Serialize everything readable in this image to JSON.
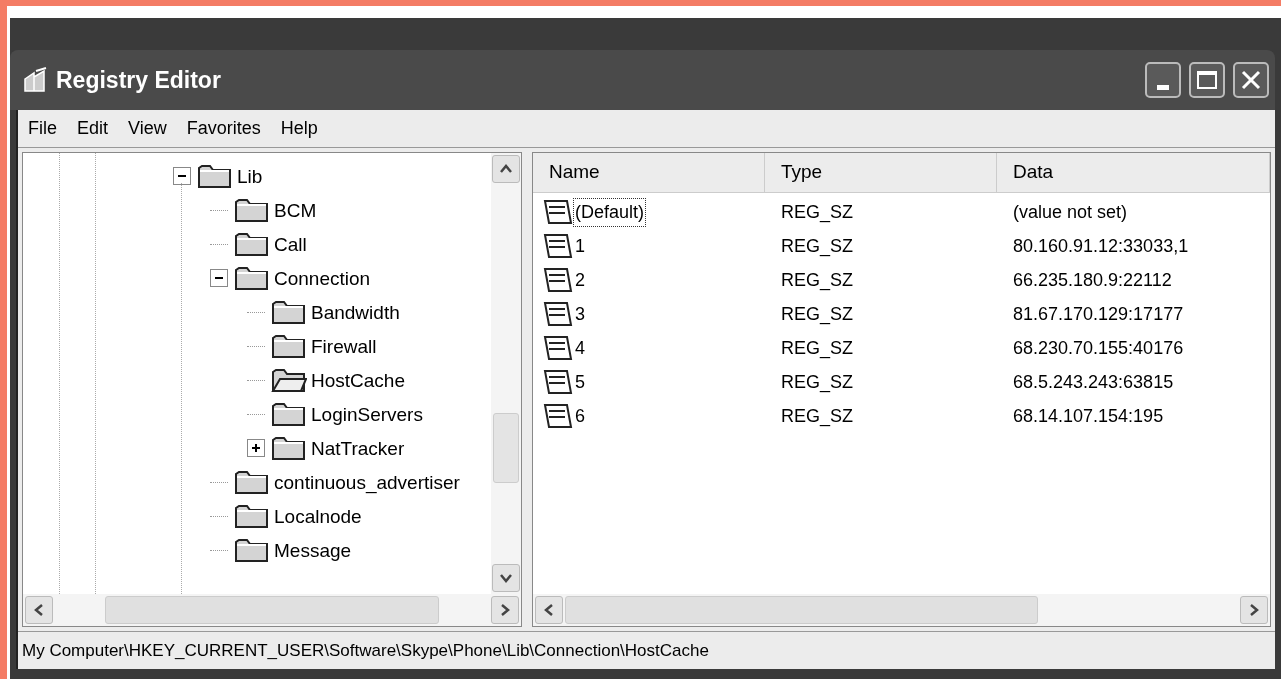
{
  "window": {
    "title": "Registry Editor"
  },
  "menu": [
    "File",
    "Edit",
    "View",
    "Favorites",
    "Help"
  ],
  "tree": [
    {
      "label": "Lib",
      "expanded": true,
      "selected": false,
      "children": [
        {
          "label": "BCM",
          "selected": false
        },
        {
          "label": "Call",
          "selected": false
        },
        {
          "label": "Connection",
          "expanded": true,
          "selected": false,
          "children": [
            {
              "label": "Bandwidth",
              "selected": false
            },
            {
              "label": "Firewall",
              "selected": false
            },
            {
              "label": "HostCache",
              "selected": true
            },
            {
              "label": "LoginServers",
              "selected": false
            },
            {
              "label": "NatTracker",
              "expanded": false,
              "selected": false
            }
          ]
        },
        {
          "label": "continuous_advertiser",
          "selected": false
        },
        {
          "label": "Localnode",
          "selected": false
        },
        {
          "label": "Message",
          "selected": false
        }
      ]
    }
  ],
  "table": {
    "columns": [
      "Name",
      "Type",
      "Data"
    ],
    "rows": [
      {
        "name": "(Default)",
        "type": "REG_SZ",
        "data": "(value not set)",
        "focused": true
      },
      {
        "name": "1",
        "type": "REG_SZ",
        "data": "80.160.91.12:33033,1",
        "focused": false
      },
      {
        "name": "2",
        "type": "REG_SZ",
        "data": "66.235.180.9:22112",
        "focused": false
      },
      {
        "name": "3",
        "type": "REG_SZ",
        "data": "81.67.170.129:17177",
        "focused": false
      },
      {
        "name": "4",
        "type": "REG_SZ",
        "data": "68.230.70.155:40176",
        "focused": false
      },
      {
        "name": "5",
        "type": "REG_SZ",
        "data": "68.5.243.243:63815",
        "focused": false
      },
      {
        "name": "6",
        "type": "REG_SZ",
        "data": "68.14.107.154:195",
        "focused": false
      }
    ]
  },
  "status_bar": "My Computer\\HKEY_CURRENT_USER\\Software\\Skype\\Phone\\Lib\\Connection\\HostCache"
}
